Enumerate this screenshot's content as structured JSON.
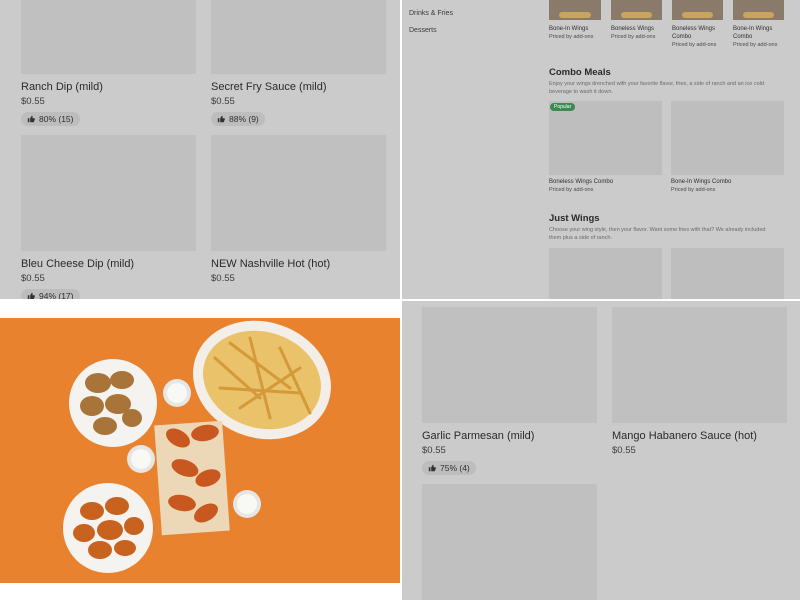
{
  "top_left": {
    "items": [
      {
        "name": "Ranch Dip (mild)",
        "price": "$0.55",
        "rating": "80% (15)"
      },
      {
        "name": "Secret Fry Sauce (mild)",
        "price": "$0.55",
        "rating": "88% (9)"
      },
      {
        "name": "Bleu Cheese Dip (mild)",
        "price": "$0.55",
        "rating": "94% (17)"
      },
      {
        "name": "NEW Nashville Hot (hot)",
        "price": "$0.55"
      }
    ]
  },
  "top_right": {
    "nav": [
      "Drinks & Fries",
      "Desserts"
    ],
    "top_items": [
      {
        "name": "Bone-In Wings",
        "price": "Priced by add-ons"
      },
      {
        "name": "Boneless Wings",
        "price": "Priced by add-ons"
      },
      {
        "name": "Boneless Wings Combo",
        "price": "Priced by add-ons"
      },
      {
        "name": "Bone-In Wings Combo",
        "price": "Priced by add-ons"
      }
    ],
    "combo": {
      "title": "Combo Meals",
      "description": "Enjoy your wings drenched with your favorite flavor, fries, a side of ranch and an ice cold beverage to wash it down.",
      "badge": "Popular",
      "items": [
        {
          "name": "Boneless Wings Combo",
          "price": "Priced by add-ons"
        },
        {
          "name": "Bone-In Wings Combo",
          "price": "Priced by add-ons"
        }
      ]
    },
    "just_wings": {
      "title": "Just Wings",
      "description": "Choose your wing style, then your flavor. Want some fries with that? We already included them plus a side of ranch."
    }
  },
  "bottom_right": {
    "items": [
      {
        "name": "Garlic Parmesan (mild)",
        "price": "$0.55",
        "rating": "75% (4)"
      },
      {
        "name": "Mango Habanero Sauce (hot)",
        "price": "$0.55"
      }
    ]
  },
  "colors": {
    "photo_background": "#e8822e",
    "popular_badge": "#3a8a52",
    "overlay_gray": "#cbcbcb"
  }
}
